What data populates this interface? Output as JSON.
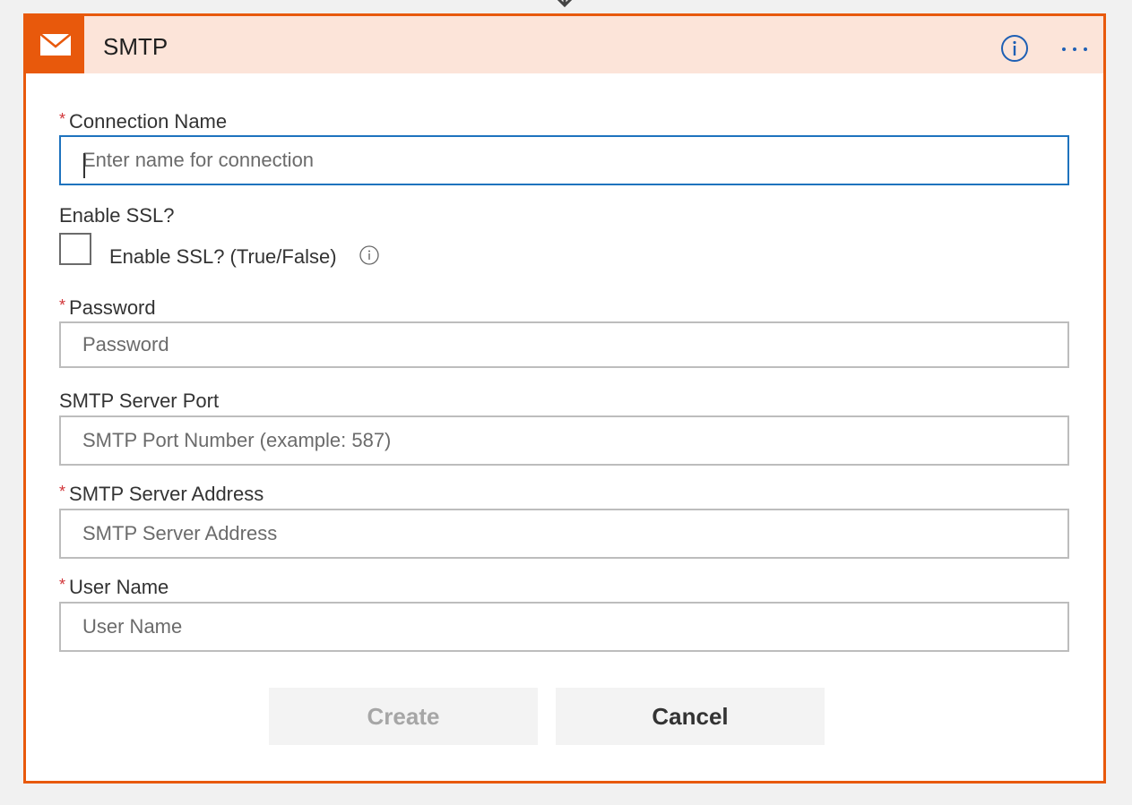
{
  "card": {
    "title": "SMTP",
    "icon": "envelope-icon",
    "accent_color": "#e8590c",
    "header_bg": "#fce4d9"
  },
  "header_actions": {
    "info_icon": "info-icon",
    "more_icon": "more-icon"
  },
  "form": {
    "connection_name": {
      "label": "Connection Name",
      "required_marker": "*",
      "placeholder": "Enter name for connection",
      "value": ""
    },
    "enable_ssl": {
      "label": "Enable SSL?",
      "checkbox_label": "Enable SSL? (True/False)",
      "checked": false
    },
    "password": {
      "label": "Password",
      "required_marker": "*",
      "placeholder": "Password",
      "value": ""
    },
    "smtp_port": {
      "label": "SMTP Server Port",
      "placeholder": "SMTP Port Number (example: 587)",
      "value": ""
    },
    "smtp_address": {
      "label": "SMTP Server Address",
      "required_marker": "*",
      "placeholder": "SMTP Server Address",
      "value": ""
    },
    "user_name": {
      "label": "User Name",
      "required_marker": "*",
      "placeholder": "User Name",
      "value": ""
    }
  },
  "buttons": {
    "create_label": "Create",
    "cancel_label": "Cancel"
  }
}
